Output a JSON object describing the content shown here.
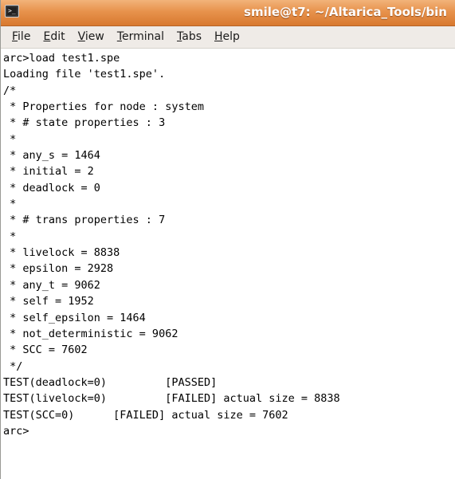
{
  "window": {
    "title": "smile@t7: ~/Altarica_Tools/bin",
    "icon": "terminal-icon"
  },
  "menu": [
    {
      "accel": "F",
      "rest": "ile"
    },
    {
      "accel": "E",
      "rest": "dit"
    },
    {
      "accel": "V",
      "rest": "iew"
    },
    {
      "accel": "T",
      "rest": "erminal"
    },
    {
      "accel": "T",
      "rest": "abs"
    },
    {
      "accel": "H",
      "rest": "elp"
    }
  ],
  "terminal": {
    "lines": [
      "arc>load test1.spe",
      "Loading file 'test1.spe'.",
      "/*",
      " * Properties for node : system",
      " * # state properties : 3",
      " *",
      " * any_s = 1464",
      " * initial = 2",
      " * deadlock = 0",
      " *",
      " * # trans properties : 7",
      " *",
      " * livelock = 8838",
      " * epsilon = 2928",
      " * any_t = 9062",
      " * self = 1952",
      " * self_epsilon = 1464",
      " * not_deterministic = 9062",
      " * SCC = 7602",
      " */",
      "TEST(deadlock=0)         [PASSED]",
      "TEST(livelock=0)         [FAILED] actual size = 8838",
      "TEST(SCC=0)      [FAILED] actual size = 7602",
      "arc>"
    ]
  }
}
